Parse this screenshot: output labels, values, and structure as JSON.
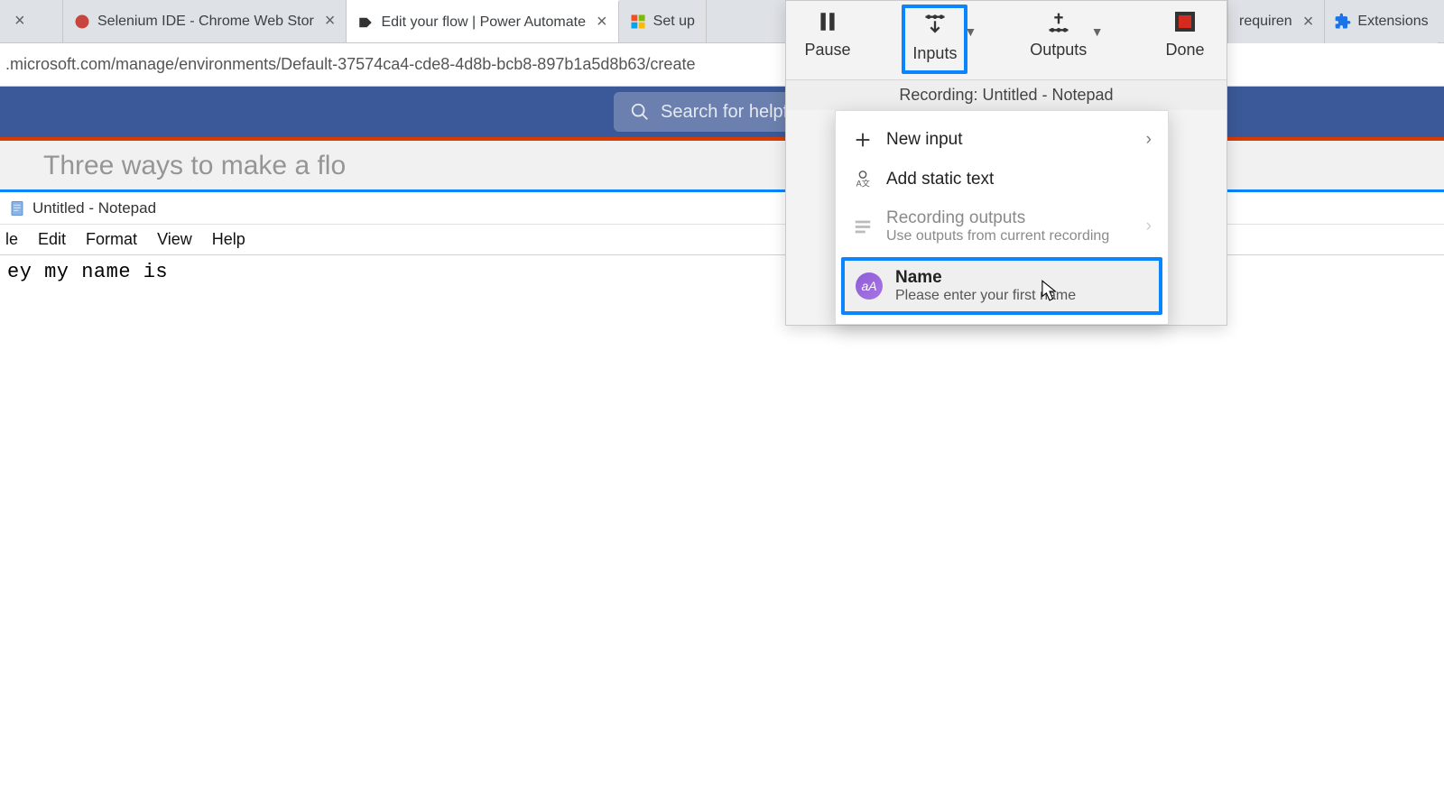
{
  "tabs": [
    {
      "title": "",
      "favicon": "generic"
    },
    {
      "title": "Selenium IDE - Chrome Web Stor",
      "favicon": "selenium"
    },
    {
      "title": "Edit your flow | Power Automate",
      "favicon": "flow",
      "active": true
    },
    {
      "title": "Set up",
      "favicon": "microsoft"
    },
    {
      "title": "requiren",
      "favicon": "generic"
    }
  ],
  "extensions_label": "Extensions",
  "address_bar": ".microsoft.com/manage/environments/Default-37574ca4-cde8-4d8b-bcb8-897b1a5d8b63/create",
  "banner": {
    "search_placeholder": "Search for helpful resources"
  },
  "headline": "Three ways to make a flo",
  "notepad": {
    "title": "Untitled - Notepad",
    "menu": [
      "le",
      "Edit",
      "Format",
      "View",
      "Help"
    ],
    "content": "ey my name is"
  },
  "recorder": {
    "buttons": {
      "pause": "Pause",
      "inputs": "Inputs",
      "outputs": "Outputs",
      "done": "Done"
    },
    "status": "Recording: Untitled - Notepad",
    "menu": {
      "new_input": "New input",
      "static_text": "Add static text",
      "rec_outputs": {
        "title": "Recording outputs",
        "sub": "Use outputs from current recording"
      },
      "name_item": {
        "title": "Name",
        "sub": "Please enter your first name"
      }
    }
  }
}
